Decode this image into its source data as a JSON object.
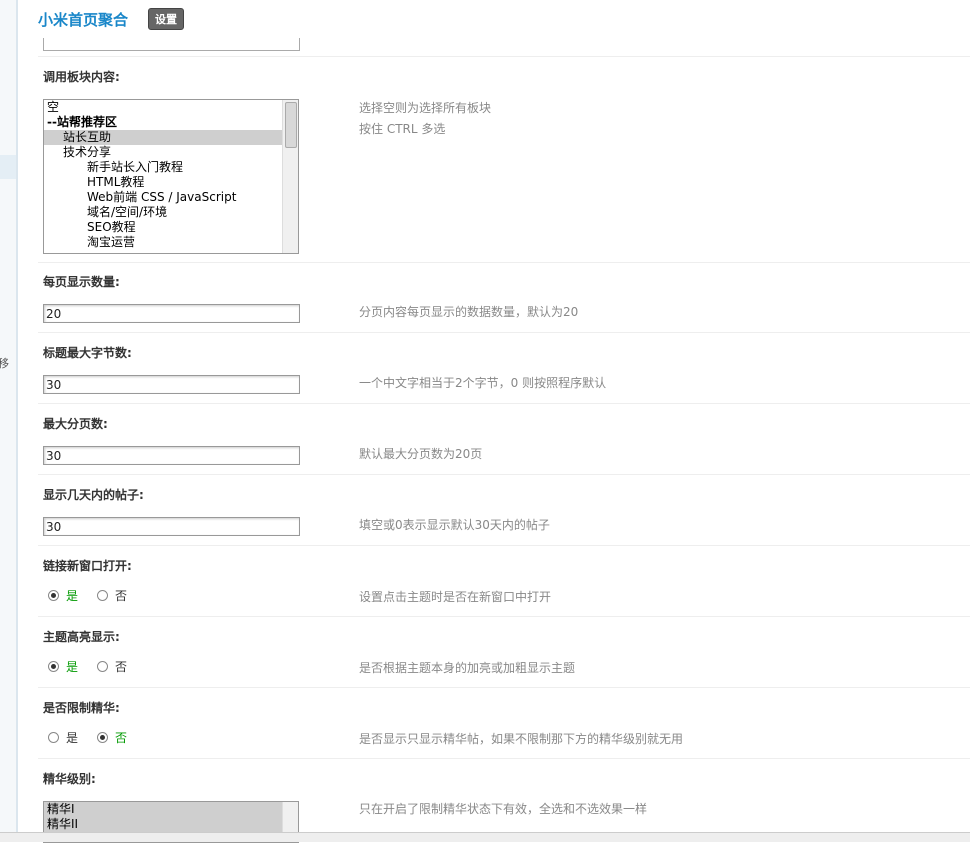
{
  "header": {
    "title": "小米首页聚合",
    "settings_label": "设置"
  },
  "sidebar": {
    "cut_text": "移"
  },
  "fields": {
    "block": {
      "label": "调用板块内容:",
      "tip1": "选择空则为选择所有板块",
      "tip2": "按住 CTRL 多选",
      "options": [
        {
          "text": "空",
          "level": 0,
          "selected": false,
          "group": false
        },
        {
          "text": "--站帮推荐区",
          "level": 0,
          "selected": false,
          "group": true
        },
        {
          "text": "站长互助",
          "level": 1,
          "selected": true,
          "group": false
        },
        {
          "text": "技术分享",
          "level": 1,
          "selected": false,
          "group": false
        },
        {
          "text": "新手站长入门教程",
          "level": 2,
          "selected": false,
          "group": false
        },
        {
          "text": "HTML教程",
          "level": 2,
          "selected": false,
          "group": false
        },
        {
          "text": "Web前端 CSS / JavaScript",
          "level": 2,
          "selected": false,
          "group": false
        },
        {
          "text": "域名/空间/环境",
          "level": 2,
          "selected": false,
          "group": false
        },
        {
          "text": "SEO教程",
          "level": 2,
          "selected": false,
          "group": false
        },
        {
          "text": "淘宝运营",
          "level": 2,
          "selected": false,
          "group": false
        }
      ]
    },
    "per_page": {
      "label": "每页显示数量:",
      "value": "20",
      "tip": "分页内容每页显示的数据数量，默认为20"
    },
    "title_len": {
      "label": "标题最大字节数:",
      "value": "30",
      "tip": "一个中文字相当于2个字节，0 则按照程序默认"
    },
    "max_pages": {
      "label": "最大分页数:",
      "value": "30",
      "tip": "默认最大分页数为20页"
    },
    "days": {
      "label": "显示几天内的帖子:",
      "value": "30",
      "tip": "填空或0表示显示默认30天内的帖子"
    },
    "new_window": {
      "label": "链接新窗口打开:",
      "yes": "是",
      "no": "否",
      "selected": "yes",
      "tip": "设置点击主题时是否在新窗口中打开"
    },
    "highlight": {
      "label": "主题高亮显示:",
      "yes": "是",
      "no": "否",
      "selected": "yes",
      "tip": "是否根据主题本身的加亮或加粗显示主题"
    },
    "limit_digest": {
      "label": "是否限制精华:",
      "yes": "是",
      "no": "否",
      "selected": "no",
      "tip": "是否显示只显示精华帖，如果不限制那下方的精华级别就无用"
    },
    "digest_level": {
      "label": "精华级别:",
      "tip": "只在开启了限制精华状态下有效，全选和不选效果一样",
      "options": [
        {
          "text": "精华I",
          "selected": true
        },
        {
          "text": "精华II",
          "selected": true
        }
      ]
    }
  },
  "colors": {
    "title": "#1a87c9",
    "active_radio_label": "#009900",
    "tip": "#888888"
  }
}
